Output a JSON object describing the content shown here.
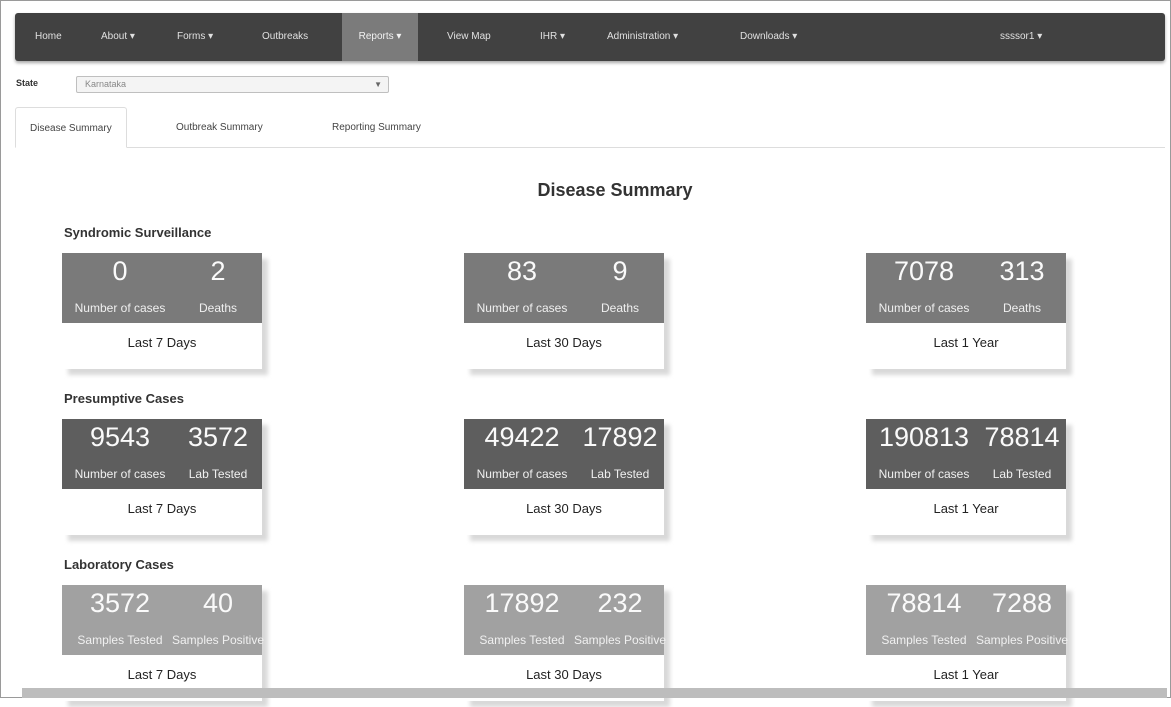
{
  "nav": {
    "items": [
      {
        "label": "Home"
      },
      {
        "label": "About ▾"
      },
      {
        "label": "Forms ▾"
      },
      {
        "label": "Outbreaks"
      },
      {
        "label": "Reports ▾"
      },
      {
        "label": "View Map"
      },
      {
        "label": "IHR ▾"
      },
      {
        "label": "Administration ▾"
      },
      {
        "label": "Downloads ▾"
      }
    ],
    "user": "ssssor1 ▾"
  },
  "state": {
    "label": "State",
    "value": "Karnataka"
  },
  "tabs": [
    {
      "label": "Disease Summary"
    },
    {
      "label": "Outbreak Summary"
    },
    {
      "label": "Reporting Summary"
    }
  ],
  "page_title": "Disease Summary",
  "colors": {
    "syndromic": "#7a7a7a",
    "presumptive": "#5e5e5e",
    "laboratory": "#a1a1a1",
    "navbar": "#414141"
  },
  "sections": [
    {
      "title": "Syndromic Surveillance",
      "cards": [
        {
          "left_value": "0",
          "left_label": "Number of cases",
          "right_value": "2",
          "right_label": "Deaths",
          "period": "Last 7 Days"
        },
        {
          "left_value": "83",
          "left_label": "Number of cases",
          "right_value": "9",
          "right_label": "Deaths",
          "period": "Last 30 Days"
        },
        {
          "left_value": "7078",
          "left_label": "Number of cases",
          "right_value": "313",
          "right_label": "Deaths",
          "period": "Last 1 Year"
        }
      ]
    },
    {
      "title": "Presumptive Cases",
      "cards": [
        {
          "left_value": "9543",
          "left_label": "Number of cases",
          "right_value": "3572",
          "right_label": "Lab Tested",
          "period": "Last 7 Days"
        },
        {
          "left_value": "49422",
          "left_label": "Number of cases",
          "right_value": "17892",
          "right_label": "Lab Tested",
          "period": "Last 30 Days"
        },
        {
          "left_value": "190813",
          "left_label": "Number of cases",
          "right_value": "78814",
          "right_label": "Lab Tested",
          "period": "Last 1 Year"
        }
      ]
    },
    {
      "title": "Laboratory Cases",
      "cards": [
        {
          "left_value": "3572",
          "left_label": "Samples Tested",
          "right_value": "40",
          "right_label": "Samples Positive",
          "period": "Last 7 Days"
        },
        {
          "left_value": "17892",
          "left_label": "Samples Tested",
          "right_value": "232",
          "right_label": "Samples Positive",
          "period": "Last 30 Days"
        },
        {
          "left_value": "78814",
          "left_label": "Samples Tested",
          "right_value": "7288",
          "right_label": "Samples Positive",
          "period": "Last 1 Year"
        }
      ]
    }
  ]
}
